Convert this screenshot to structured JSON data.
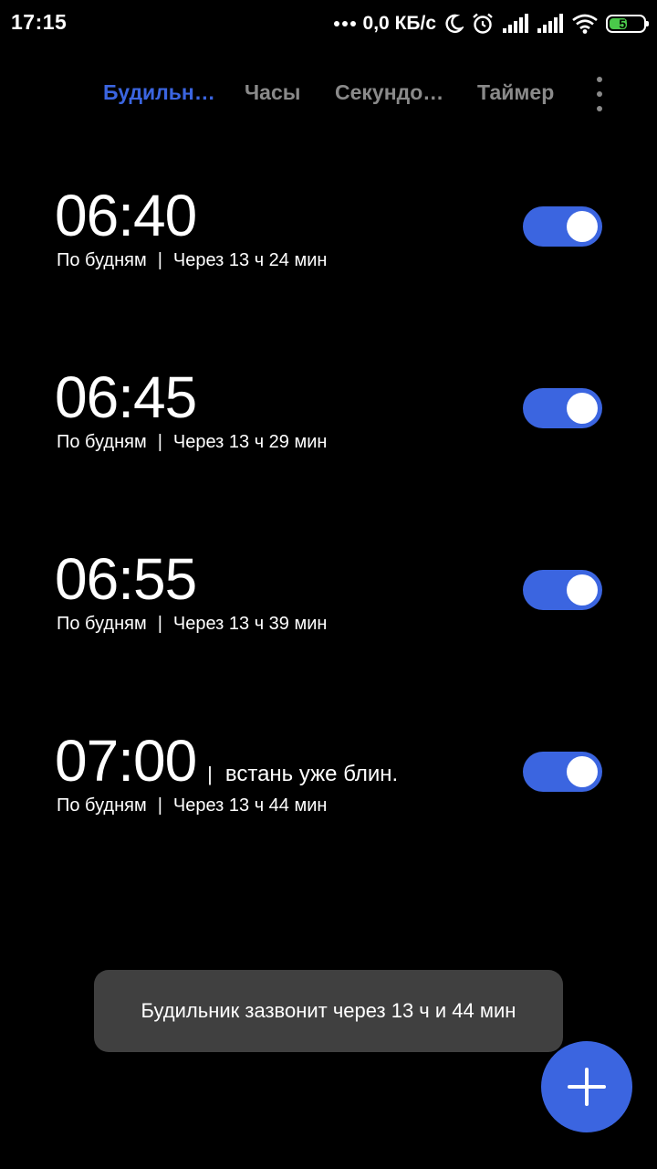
{
  "status_bar": {
    "time": "17:15",
    "net_speed": "0,0 КБ/с",
    "battery_level": "52",
    "battery_fraction": 0.52,
    "icons": [
      "more-dots-icon",
      "moon-icon",
      "alarm-clock-icon",
      "signal-icon",
      "signal-icon",
      "wifi-icon",
      "battery-icon"
    ]
  },
  "tabs": [
    {
      "label": "Будильн…",
      "active": true
    },
    {
      "label": "Часы",
      "active": false
    },
    {
      "label": "Секундо…",
      "active": false
    },
    {
      "label": "Таймер",
      "active": false
    }
  ],
  "alarms": [
    {
      "time": "06:40",
      "label": "",
      "repeat": "По будням",
      "separator": "|",
      "countdown": "Через 13 ч 24 мин",
      "enabled": true
    },
    {
      "time": "06:45",
      "label": "",
      "repeat": "По будням",
      "separator": "|",
      "countdown": "Через 13 ч 29 мин",
      "enabled": true
    },
    {
      "time": "06:55",
      "label": "",
      "repeat": "По будням",
      "separator": "|",
      "countdown": "Через 13 ч 39 мин",
      "enabled": true
    },
    {
      "time": "07:00",
      "label": "встань уже блин.",
      "label_separator": "|",
      "repeat": "По будням",
      "separator": "|",
      "countdown": "Через 13 ч 44 мин",
      "enabled": true
    }
  ],
  "toast": {
    "text": "Будильник зазвонит через 13 ч и 44 мин"
  },
  "fab": {
    "icon": "plus-icon"
  },
  "colors": {
    "accent": "#3b65e0",
    "background": "#000000",
    "inactive_tab": "#8a8a8a",
    "toast_bg": "#404040",
    "battery_fill": "#4ac94a"
  }
}
